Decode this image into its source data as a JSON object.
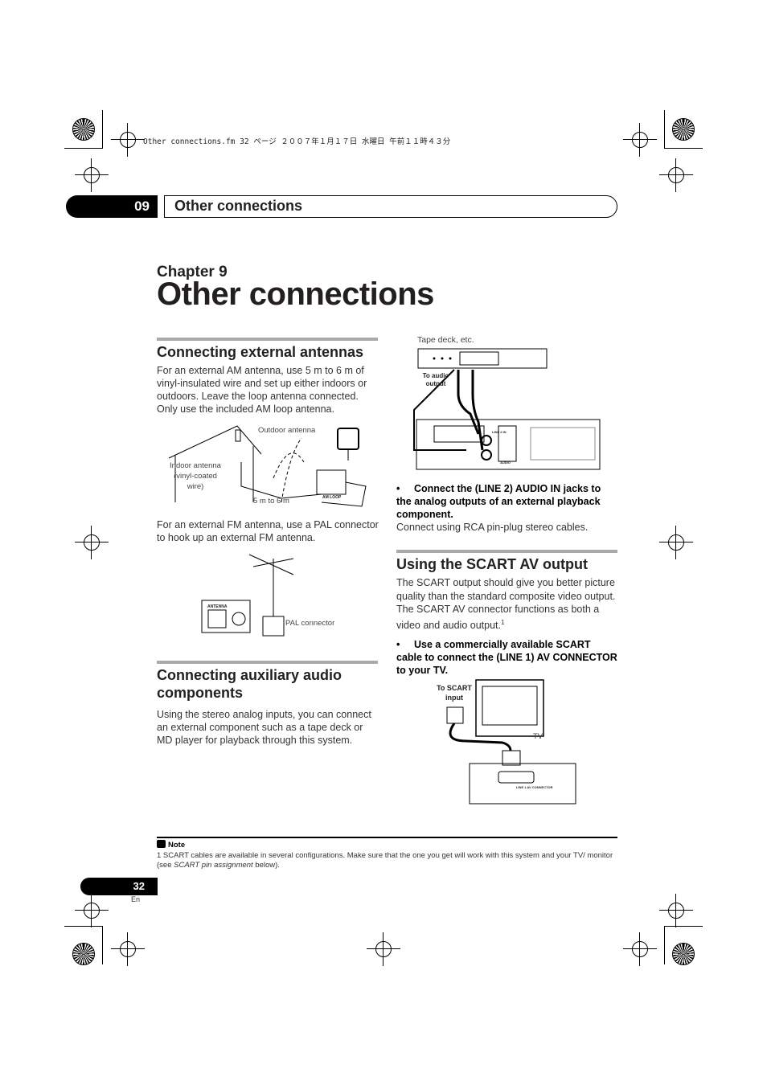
{
  "print_info": "Other connections.fm  32 ページ  ２００７年１月１７日  水曜日  午前１１時４３分",
  "header": {
    "chapter_number": "09",
    "title": "Other connections"
  },
  "chapter_label": "Chapter 9",
  "page_title": "Other connections",
  "antennas": {
    "heading": "Connecting external antennas",
    "intro": "For an external AM antenna, use 5 m to 6 m of vinyl-insulated wire and set up either indoors or outdoors. Leave the loop antenna connected. Only use the included AM loop antenna.",
    "am_diagram": {
      "outdoor": "Outdoor antenna",
      "indoor": "Indoor antenna (vinyl-coated wire)",
      "length": "5 m to 6 m",
      "terminal": "AM LOOP"
    },
    "fm_text": "For an external FM antenna, use a PAL connector to hook up an external FM antenna.",
    "fm_diagram": {
      "terminal": "ANTENNA",
      "connector": "PAL connector"
    }
  },
  "aux": {
    "heading": "Connecting auxiliary audio components",
    "body": "Using the stereo analog inputs, you can connect an external component such as a tape deck or MD player for playback through this system."
  },
  "tape_diagram": {
    "device": "Tape deck, etc.",
    "output": "To audio output",
    "jack": "LINE 2 IN",
    "panel": "AUDIO"
  },
  "line2": {
    "bullet": "•",
    "step": "Connect the (LINE 2) AUDIO IN jacks to the analog outputs of an external playback component.",
    "note": "Connect using RCA pin-plug stereo cables."
  },
  "scart": {
    "heading": "Using the SCART AV output",
    "body": "The SCART output should give you better picture quality than the standard composite video output. The SCART AV connector functions as both a video and audio output.",
    "footnote_ref": "1",
    "bullet": "•",
    "step": "Use a commercially available SCART cable to connect the (LINE 1) AV CONNECTOR to your TV.",
    "diagram": {
      "input": "To SCART input",
      "tv": "TV",
      "connector": "LINE 1 AV CONNECTOR"
    }
  },
  "note": {
    "label": "Note",
    "text_before": "1 SCART cables are available in several configurations. Make sure that the one you get will work with this system and your TV/ monitor (see ",
    "text_italic": "SCART pin assignment",
    "text_after": " below)."
  },
  "footer": {
    "page_number": "32",
    "lang": "En"
  }
}
